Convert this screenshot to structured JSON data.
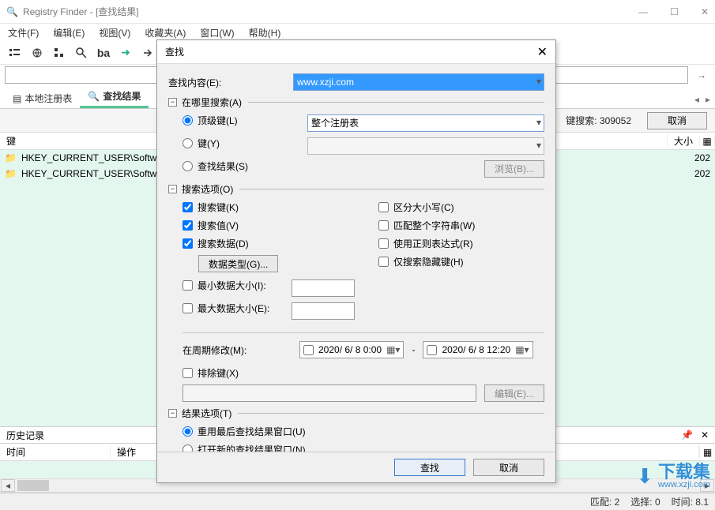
{
  "window": {
    "title": "Registry Finder - [查找结果]",
    "buttons": {
      "min": "—",
      "max": "☐",
      "close": "✕"
    }
  },
  "menu": {
    "file": "文件(F)",
    "edit": "编辑(E)",
    "view": "视图(V)",
    "fav": "收藏夹(A)",
    "window": "窗口(W)",
    "help": "帮助(H)"
  },
  "tabs": {
    "local": "本地注册表",
    "results": "查找结果"
  },
  "status_search": {
    "label_prefix": "键搜索: ",
    "count": "309052",
    "cancel": "取消"
  },
  "columns": {
    "key": "键",
    "size": "大小"
  },
  "rows": [
    {
      "key": "HKEY_CURRENT_USER\\Softwa",
      "date": "202"
    },
    {
      "key": "HKEY_CURRENT_USER\\Softwa",
      "date": "202"
    }
  ],
  "history": {
    "title": "历史记录",
    "col_time": "时间",
    "col_op": "操作"
  },
  "statusbar": {
    "match": "匹配: 2",
    "select": "选择: 0",
    "time": "时间: 8.1"
  },
  "dialog": {
    "title": "查找",
    "search_content_label": "查找内容(E):",
    "search_content_value": "www.xzji.com",
    "grp_where": "在哪里搜索(A)",
    "rb_topkey": "顶级键(L)",
    "topkey_value": "整个注册表",
    "rb_key": "键(Y)",
    "rb_results": "查找结果(S)",
    "browse": "浏览(B)...",
    "grp_options": "搜索选项(O)",
    "chk_keys": "搜索键(K)",
    "chk_values": "搜索值(V)",
    "chk_data": "搜索数据(D)",
    "btn_datatypes": "数据类型(G)...",
    "chk_min": "最小数据大小(I):",
    "chk_max": "最大数据大小(E):",
    "chk_case": "区分大小写(C)",
    "chk_whole": "匹配整个字符串(W)",
    "chk_regex": "使用正则表达式(R)",
    "chk_hidden": "仅搜索隐藏键(H)",
    "date_label": "在周期修改(M):",
    "date_from": "2020/ 6/ 8  0:00",
    "date_to": "2020/ 6/ 8 12:20",
    "chk_exclude": "排除键(X)",
    "btn_edit": "编辑(E)...",
    "grp_result": "结果选项(T)",
    "rb_reuse": "重用最后查找结果窗口(U)",
    "rb_new": "打开新的查找结果窗口(N)",
    "btn_find": "查找",
    "btn_cancel": "取消"
  },
  "watermark": {
    "name": "下载集",
    "url": "www.xzji.com"
  }
}
